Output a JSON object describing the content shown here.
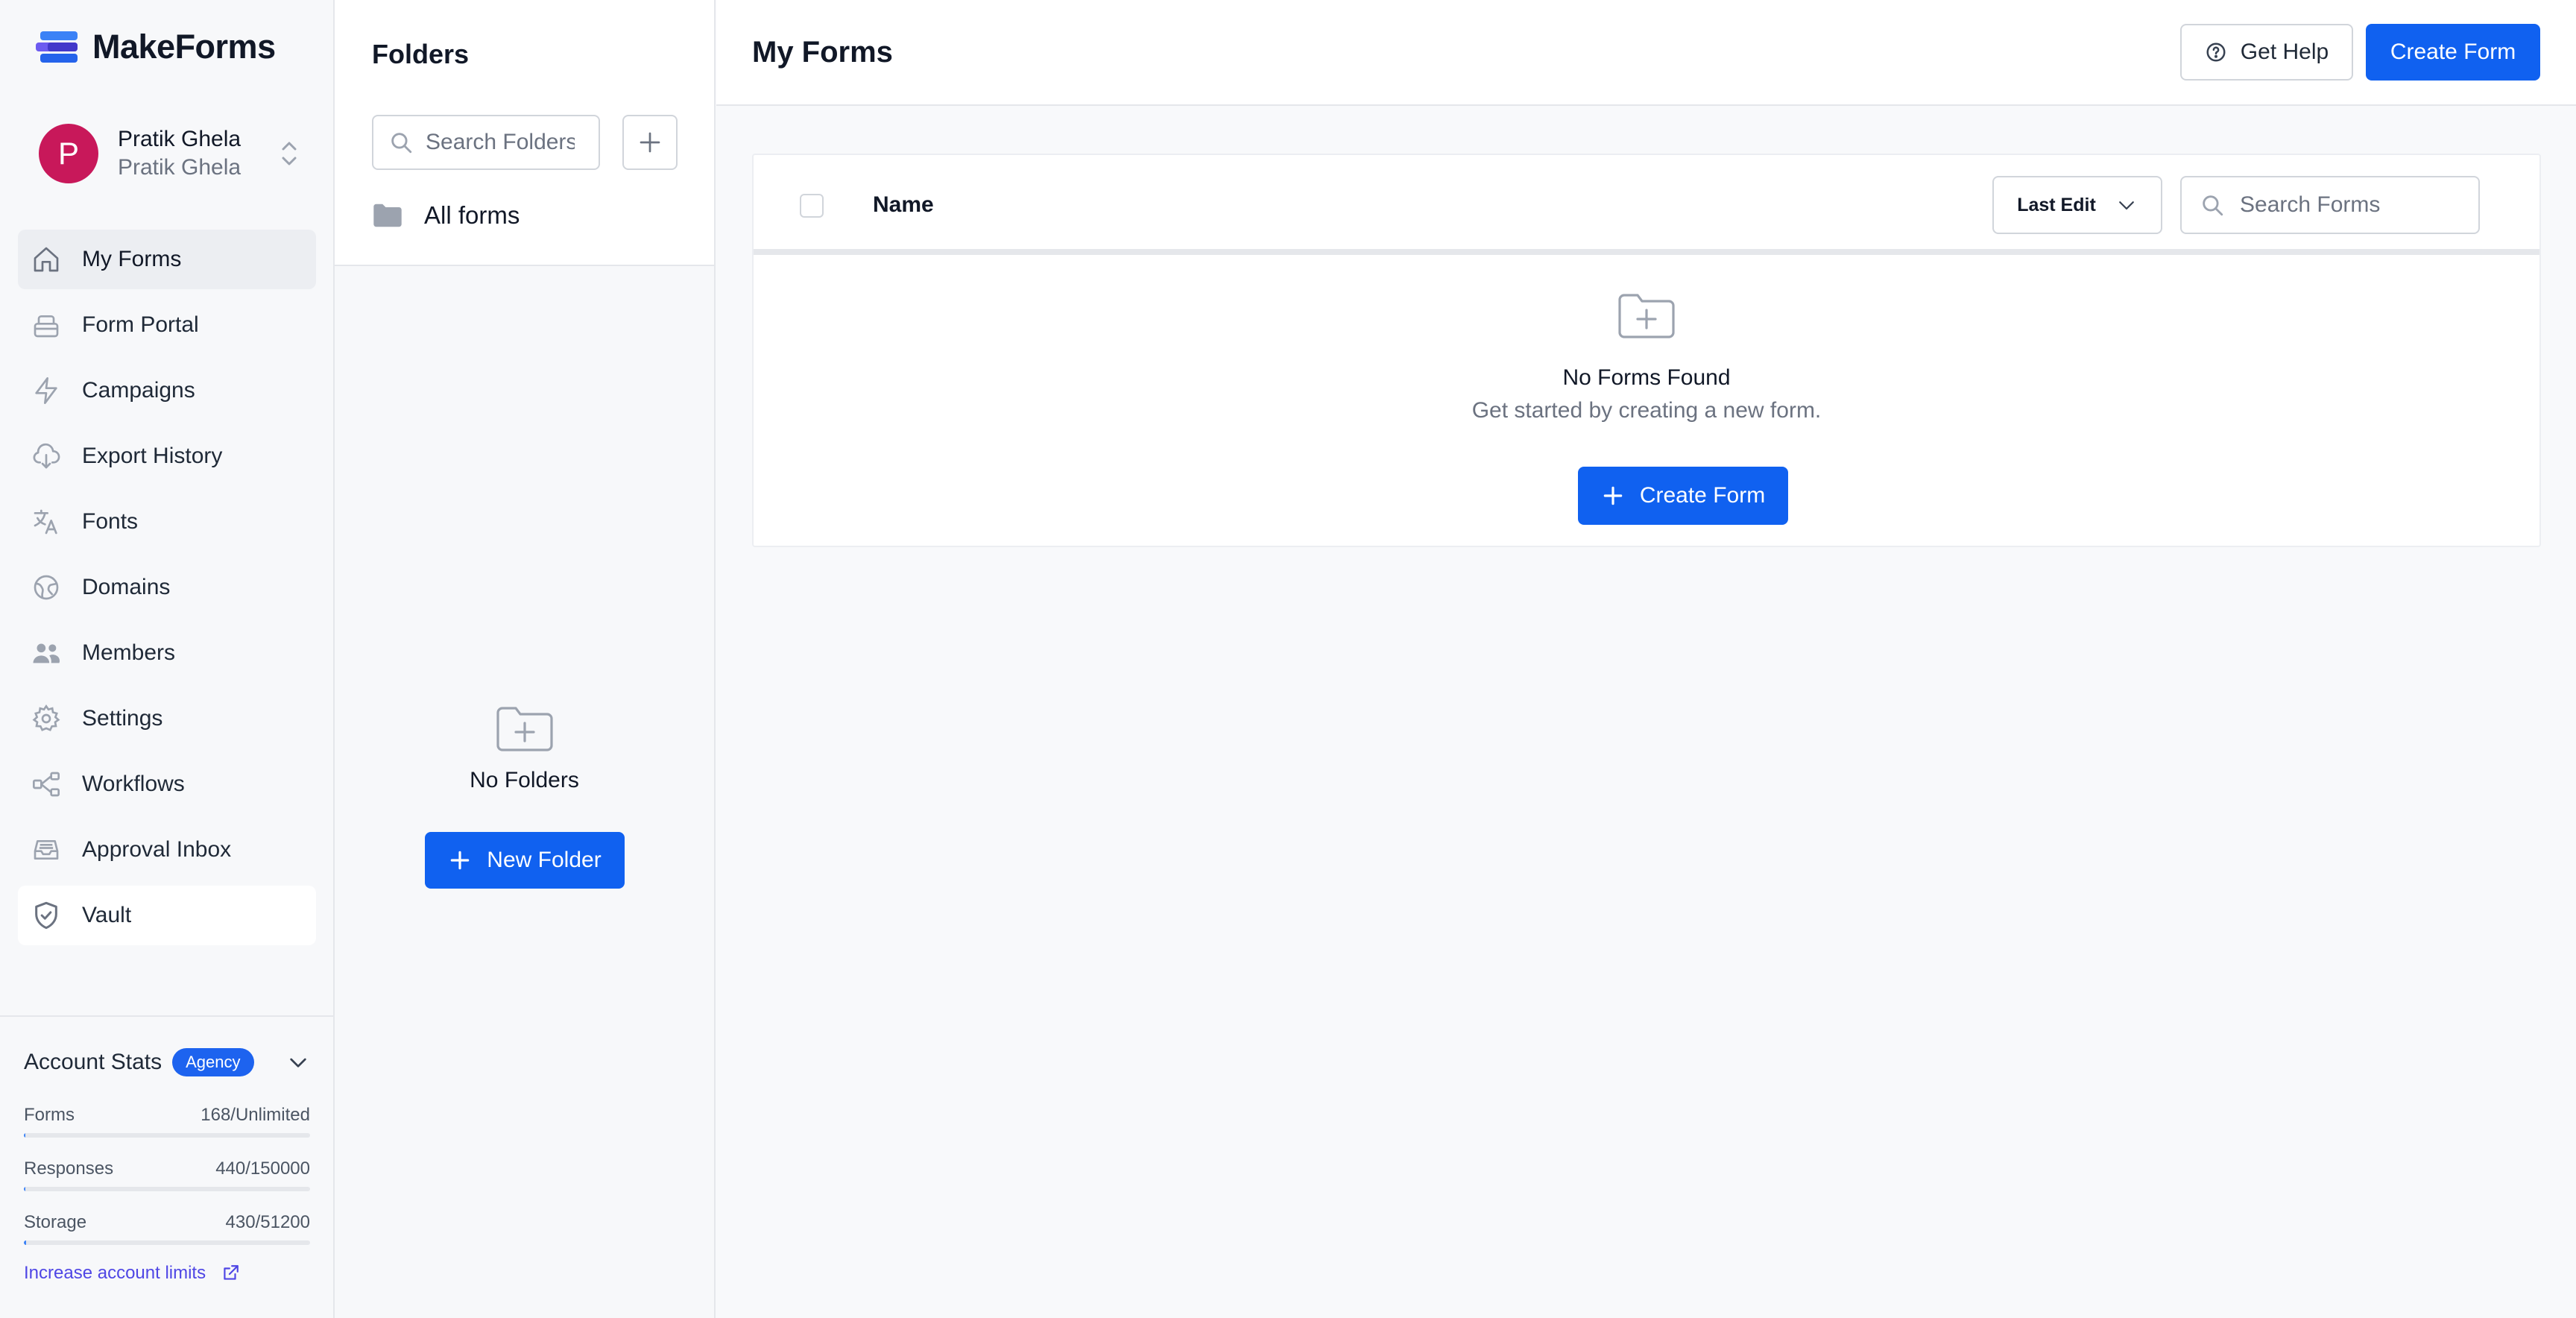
{
  "app": {
    "name": "MakeForms"
  },
  "account": {
    "initial": "P",
    "name": "Pratik Ghela",
    "workspace": "Pratik Ghela"
  },
  "nav": [
    {
      "label": "My Forms",
      "icon": "home-icon"
    },
    {
      "label": "Form Portal",
      "icon": "portal-icon"
    },
    {
      "label": "Campaigns",
      "icon": "lightning-icon"
    },
    {
      "label": "Export History",
      "icon": "cloud-download-icon"
    },
    {
      "label": "Fonts",
      "icon": "translate-icon"
    },
    {
      "label": "Domains",
      "icon": "globe-icon"
    },
    {
      "label": "Members",
      "icon": "users-icon"
    },
    {
      "label": "Settings",
      "icon": "gear-icon"
    },
    {
      "label": "Workflows",
      "icon": "workflow-icon"
    },
    {
      "label": "Approval Inbox",
      "icon": "inbox-icon"
    },
    {
      "label": "Vault",
      "icon": "shield-icon"
    }
  ],
  "stats": {
    "title": "Account Stats",
    "badge": "Agency",
    "items": [
      {
        "label": "Forms",
        "value": "168/Unlimited",
        "fraction": 0.0
      },
      {
        "label": "Responses",
        "value": "440/150000",
        "fraction": 0.003
      },
      {
        "label": "Storage",
        "value": "430/51200",
        "fraction": 0.008
      }
    ],
    "link": "Increase account limits"
  },
  "folders": {
    "title": "Folders",
    "search_placeholder": "Search Folders",
    "all_forms": "All forms",
    "empty_text": "No Folders",
    "new_folder_label": "New Folder"
  },
  "main": {
    "title": "My Forms",
    "help_label": "Get Help",
    "create_label": "Create Form",
    "table": {
      "col_name": "Name",
      "sort_label": "Last Edit",
      "search_placeholder": "Search Forms"
    },
    "empty": {
      "title": "No Forms Found",
      "subtitle": "Get started by creating a new form.",
      "button": "Create Form"
    }
  },
  "colors": {
    "primary": "#1061f0",
    "avatar": "#c8185a",
    "badge": "#1d63ef",
    "link": "#4f46e5"
  }
}
